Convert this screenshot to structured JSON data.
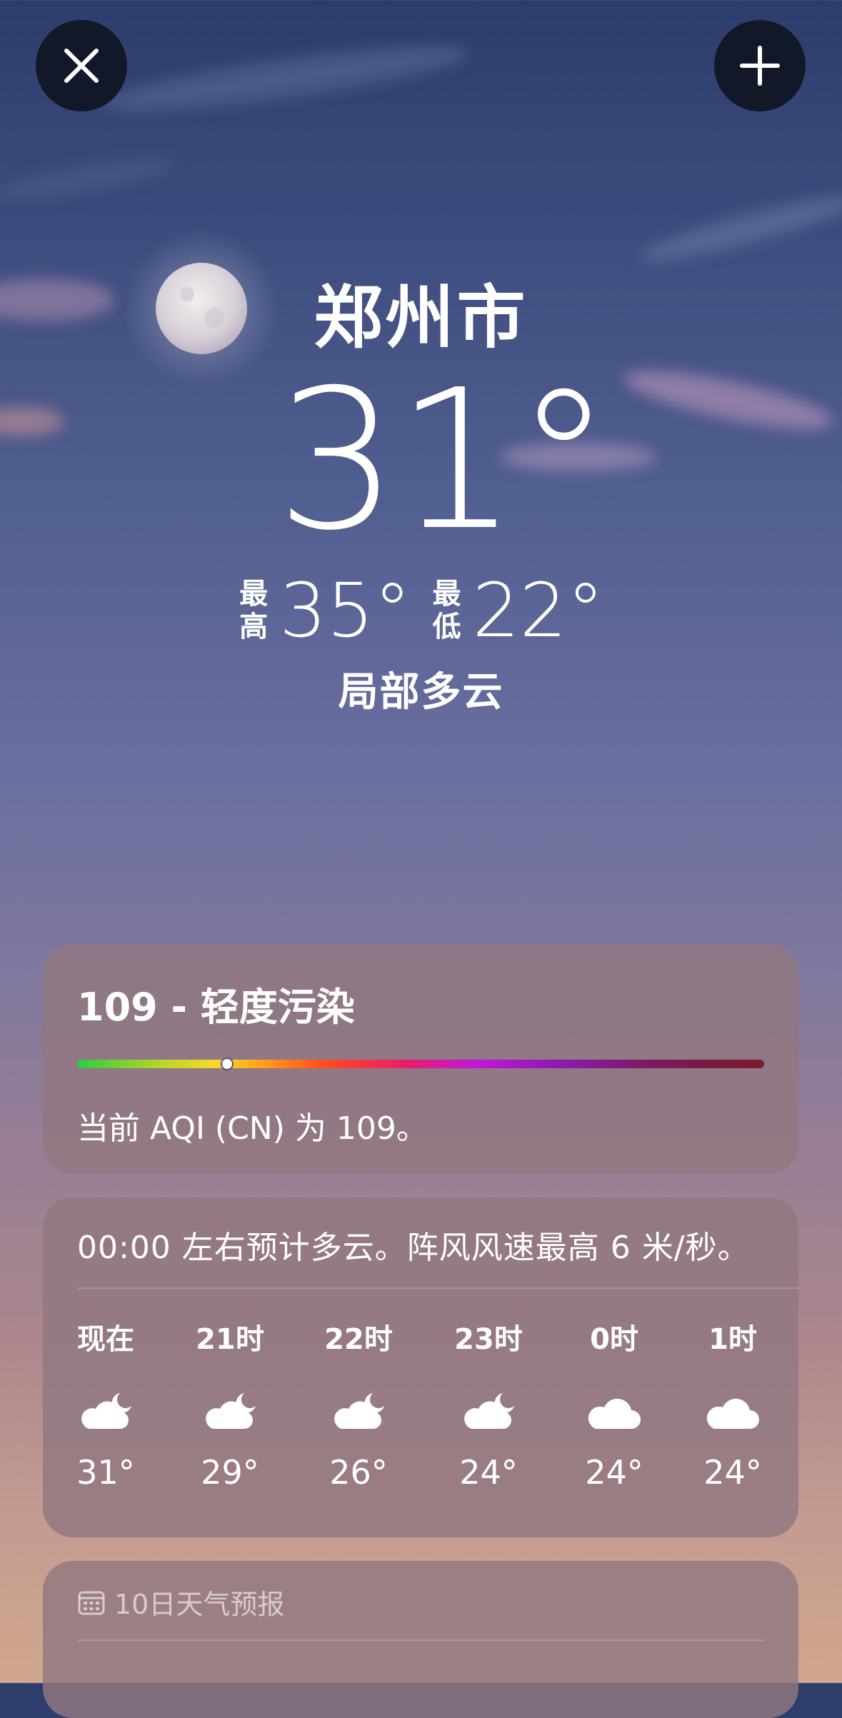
{
  "buttons": {
    "close_icon": "close-icon",
    "add_icon": "plus-icon"
  },
  "location": {
    "city": "郑州市",
    "temperature": "31°",
    "high_label": "最高",
    "high": "35°",
    "low_label": "最低",
    "low": "22°",
    "condition": "局部多云"
  },
  "aqi": {
    "title": "109 - 轻度污染",
    "value": 109,
    "description": "当前 AQI (CN) 为 109。"
  },
  "hourly": {
    "summary": "00:00 左右预计多云。阵风风速最高 6 米/秒。",
    "items": [
      {
        "time": "现在",
        "icon": "cloud-moon-icon",
        "temp": "31°"
      },
      {
        "time": "21时",
        "icon": "cloud-moon-icon",
        "temp": "29°"
      },
      {
        "time": "22时",
        "icon": "cloud-moon-icon",
        "temp": "26°"
      },
      {
        "time": "23时",
        "icon": "cloud-moon-icon",
        "temp": "24°"
      },
      {
        "time": "0时",
        "icon": "cloud-icon",
        "temp": "24°"
      },
      {
        "time": "1时",
        "icon": "cloud-icon",
        "temp": "24°"
      }
    ]
  },
  "forecast": {
    "title": "10日天气预报",
    "icon": "calendar-icon"
  }
}
